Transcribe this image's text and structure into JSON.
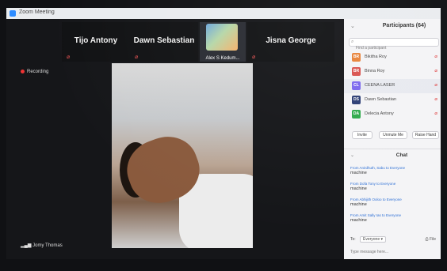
{
  "window": {
    "title": "Zoom Meeting"
  },
  "top_strip": {
    "tiles": [
      {
        "name": "Tijo Antony"
      },
      {
        "name": "Dawn Sebastian"
      },
      {
        "name": "Alex S Kedum..."
      },
      {
        "name": "Jisna George"
      }
    ]
  },
  "meeting": {
    "recording_label": "Recording",
    "active_speaker": "Jomy Thomas"
  },
  "participants": {
    "title": "Participants (64)",
    "search_placeholder": "Find a participant",
    "items": [
      {
        "initials": "BR",
        "name": "Bikitha Roy",
        "color": "#e8833a"
      },
      {
        "initials": "BR",
        "name": "Binna Roy",
        "color": "#d9534f"
      },
      {
        "initials": "CL",
        "name": "CEENA LASER",
        "color": "#7b68ee"
      },
      {
        "initials": "DS",
        "name": "Dawn Sebastian",
        "color": "#2c3e75"
      },
      {
        "initials": "DA",
        "name": "Delecia Antony",
        "color": "#2eaa4a"
      }
    ],
    "actions": [
      "Invite",
      "Unmute Me",
      "Raise Hand"
    ]
  },
  "chat": {
    "title": "Chat",
    "messages": [
      {
        "from": "From Anirdhuth, Sabu to Everyone",
        "text": "machine"
      },
      {
        "from": "From Dofa Tony to Everyone",
        "text": "machine"
      },
      {
        "from": "From Abhijith Ooloo to Everyone",
        "text": "machine"
      },
      {
        "from": "From Amit Sally Ias to Everyone",
        "text": "machine"
      }
    ],
    "to_label": "To:",
    "recipient": "Everyone",
    "file_label": "File",
    "input_placeholder": "Type message here..."
  },
  "colors": {
    "accent": "#2d8cff",
    "mute_red": "#e55555"
  }
}
